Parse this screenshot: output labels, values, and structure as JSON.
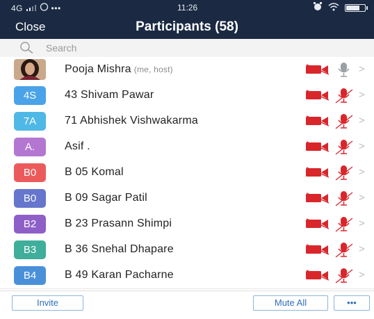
{
  "status": {
    "carrier": "4G",
    "dots": "•••",
    "time": "11:26"
  },
  "header": {
    "close_label": "Close",
    "title": "Participants (58)"
  },
  "search": {
    "placeholder": "Search"
  },
  "colors": {
    "header_bg": "#1b2a42",
    "muted_red": "#d9262b",
    "mic_gray": "#9aa0a6",
    "button_text": "#2e6fb5"
  },
  "participants": [
    {
      "initials": "",
      "name": "Pooja Mishra",
      "tag": "(me, host)",
      "avatar_color": "",
      "video": "video-off",
      "mic": "mic-on"
    },
    {
      "initials": "4S",
      "name": "43 Shivam Pawar",
      "tag": "",
      "avatar_color": "#4aa3e8",
      "video": "video-off",
      "mic": "mic-muted"
    },
    {
      "initials": "7A",
      "name": "71 Abhishek Vishwakarma",
      "tag": "",
      "avatar_color": "#4fb8e6",
      "video": "video-off",
      "mic": "mic-muted"
    },
    {
      "initials": "A.",
      "name": "Asif .",
      "tag": "",
      "avatar_color": "#b477d1",
      "video": "video-off",
      "mic": "mic-muted"
    },
    {
      "initials": "B0",
      "name": "B 05 Komal",
      "tag": "",
      "avatar_color": "#ec5b5b",
      "video": "video-off",
      "mic": "mic-muted"
    },
    {
      "initials": "B0",
      "name": "B 09 Sagar Patil",
      "tag": "",
      "avatar_color": "#6676cc",
      "video": "video-off",
      "mic": "mic-muted"
    },
    {
      "initials": "B2",
      "name": "B 23 Prasann Shimpi",
      "tag": "",
      "avatar_color": "#8e5fc7",
      "video": "video-off",
      "mic": "mic-muted"
    },
    {
      "initials": "B3",
      "name": "B 36 Snehal Dhapare",
      "tag": "",
      "avatar_color": "#3fae9a",
      "video": "video-off",
      "mic": "mic-muted"
    },
    {
      "initials": "B4",
      "name": "B 49 Karan Pacharne",
      "tag": "",
      "avatar_color": "#4a90d9",
      "video": "video-off",
      "mic": "mic-muted"
    }
  ],
  "footer": {
    "invite_label": "Invite",
    "mute_all_label": "Mute All",
    "more_label": "•••"
  }
}
